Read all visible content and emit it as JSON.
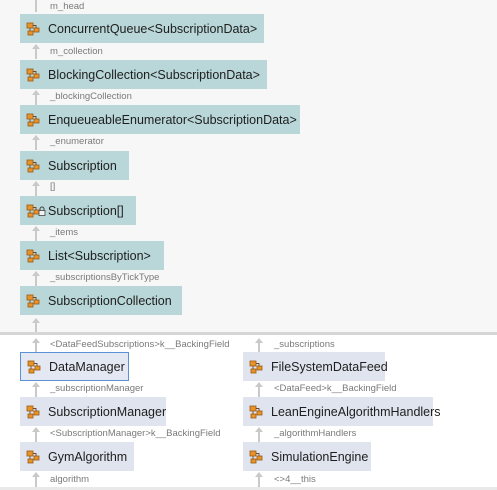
{
  "top_chain": [
    {
      "edge": "m_head",
      "type": "ConcurrentQueue<SubscriptionData>"
    },
    {
      "edge": "m_collection",
      "type": "BlockingCollection<SubscriptionData>"
    },
    {
      "edge": "_blockingCollection",
      "type": "EnqueueableEnumerator<SubscriptionData>"
    },
    {
      "edge": "_enumerator",
      "type": "Subscription"
    },
    {
      "edge": "[]",
      "type": "Subscription[]"
    },
    {
      "edge": "_items",
      "type": "List<Subscription>"
    },
    {
      "edge": "_subscriptionsByTickType",
      "type": "SubscriptionCollection"
    }
  ],
  "left_column": [
    {
      "edge": "<DataFeedSubscriptions>k__BackingField",
      "type": "DataManager",
      "selected": true
    },
    {
      "edge": "_subscriptionManager",
      "type": "SubscriptionManager"
    },
    {
      "edge": "<SubscriptionManager>k__BackingField",
      "type": "GymAlgorithm"
    },
    {
      "edge": "algorithm"
    }
  ],
  "right_column": [
    {
      "edge": "_subscriptions",
      "type": "FileSystemDataFeed"
    },
    {
      "edge": "<DataFeed>k__BackingField",
      "type": "LeanEngineAlgorithmHandlers"
    },
    {
      "edge": "_algorithmHandlers",
      "type": "SimulationEngine"
    },
    {
      "edge": "<>4__this"
    }
  ],
  "icon": "class-icon",
  "lock_icon": "lock-icon",
  "colors": {
    "teal_node": "#b9d6d8",
    "lavender_node": "#dfe4ee",
    "selected_border": "#5b8fd6",
    "icon_orange": "#e8922a"
  }
}
